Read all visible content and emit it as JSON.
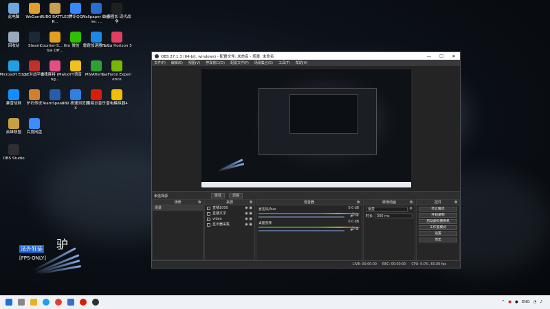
{
  "desktop": {
    "icons": [
      {
        "label": "此电脑",
        "color": "#6fa8dc"
      },
      {
        "label": "WeGame",
        "color": "#e0a030"
      },
      {
        "label": "PUBG BATTLEGR...",
        "color": "#c8a050"
      },
      {
        "label": "腾讯QQ",
        "color": "#3a86ff"
      },
      {
        "label": "Wallpaper Engine: ...",
        "color": "#2a6cd0"
      },
      {
        "label": "决赛圈加 现代战争",
        "color": "#202020"
      },
      {
        "label": "回收站",
        "color": "#9ab"
      },
      {
        "label": "Steam",
        "color": "#1b2838"
      },
      {
        "label": "Counter-S... Global Off...",
        "color": "#e0a020"
      },
      {
        "label": "微信",
        "color": "#2dc100"
      },
      {
        "label": "雷霆加速器 5.0",
        "color": "#1e88e5"
      },
      {
        "label": "Forza Horizon 5",
        "color": "#e04060"
      },
      {
        "label": "Microsoft Edge",
        "color": "#1fa0e0"
      },
      {
        "label": "5E对战平台",
        "color": "#c03030"
      },
      {
        "label": "雀魂麻将 (Mahjong...",
        "color": "#e05080"
      },
      {
        "label": "YY语音",
        "color": "#f0c020"
      },
      {
        "label": "MSIAfterb...",
        "color": "#30a030"
      },
      {
        "label": "GeForce Experience",
        "color": "#76b900"
      },
      {
        "label": "暴雪战网",
        "color": "#148eff"
      },
      {
        "label": "炉石传说",
        "color": "#d08030"
      },
      {
        "label": "TeamSpeak 3",
        "color": "#2a5caa"
      },
      {
        "label": "360 极速浏览器X",
        "color": "#3080e0"
      },
      {
        "label": "网易云音乐",
        "color": "#d81e06"
      },
      {
        "label": "雷电模拟器4",
        "color": "#f0c000"
      },
      {
        "label": "英雄联盟",
        "color": "#c8a040"
      },
      {
        "label": "百度网盘",
        "color": "#3a8cff"
      },
      {
        "label": "OBS Studio",
        "color": "#302e31"
      }
    ],
    "overlay": {
      "title": "法外狂徒",
      "big": "驴",
      "tag": "[FPS-ONLY]"
    }
  },
  "obs": {
    "title": "OBS 27.1.3 (64-bit, windows) - 配置文件: 未命名 - 场景: 未命名",
    "window_buttons": [
      "—",
      "☐",
      "✕"
    ],
    "menu": [
      "文件(F)",
      "编辑(E)",
      "视图(V)",
      "停靠窗口(D)",
      "配置文件(P)",
      "场景集合(S)",
      "工具(T)",
      "帮助(H)"
    ],
    "tabs": {
      "scene_label": "未选择源",
      "properties": "属性",
      "filters": "滤镜"
    },
    "scenes": {
      "header": "场景",
      "items": [
        "场景"
      ],
      "footer": "+ − ∧ ∨"
    },
    "sources": {
      "header": "来源",
      "items": [
        "直播1000",
        "直播文字",
        "video",
        "显示器采集"
      ],
      "footer": "+ − ⚙ ∧ ∨"
    },
    "mixer": {
      "header": "混音器",
      "rows": [
        {
          "name": "麦克风/Aux",
          "db": "0.0 dB"
        },
        {
          "name": "桌面音频",
          "db": "0.0 dB"
        }
      ]
    },
    "transitions": {
      "header": "转场动画",
      "type": "渐变",
      "duration_label": "时长",
      "duration": "300 ms"
    },
    "controls": {
      "header": "控件",
      "buttons": [
        "停止推流",
        "开始录制",
        "启动虚拟摄像机",
        "工作室模式",
        "设置",
        "退出"
      ]
    },
    "status": {
      "live": "LIVE: 00:00:00",
      "rec": "REC: 00:00:00",
      "cpu": "CPU: 0.0%, 60.00 fps"
    }
  },
  "taskbar": {
    "apps": [
      "windows-start",
      "search",
      "file-explorer",
      "edge",
      "chrome",
      "mail",
      "netease-music",
      "obs"
    ],
    "tray": {
      "lang": "ENG",
      "time": "",
      "date": ""
    }
  }
}
